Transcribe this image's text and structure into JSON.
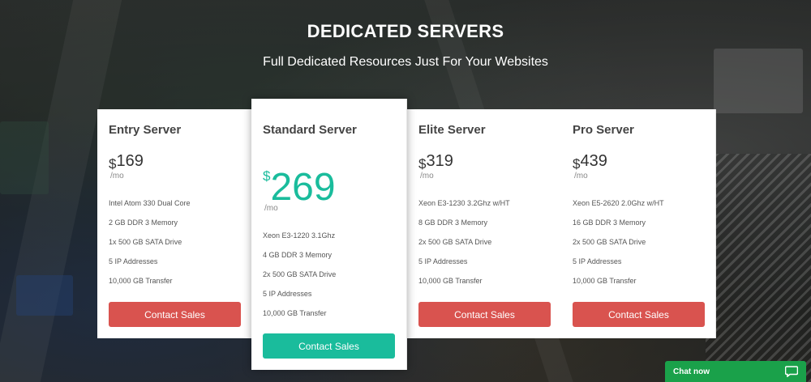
{
  "header": {
    "title": "DEDICATED SERVERS",
    "subtitle": "Full Dedicated Resources Just For Your Websites"
  },
  "plans": [
    {
      "name": "Entry Server",
      "currency": "$",
      "price": "169",
      "period": "/mo",
      "features": [
        "Intel Atom 330 Dual Core",
        "2 GB DDR 3 Memory",
        "1x 500 GB SATA Drive",
        "5 IP Addresses",
        "10,000 GB Transfer"
      ],
      "button": "Contact Sales"
    },
    {
      "name": "Standard Server",
      "currency": "$",
      "price": "269",
      "period": "/mo",
      "features": [
        "Xeon E3-1220 3.1Ghz",
        "4 GB DDR 3 Memory",
        "2x 500 GB SATA Drive",
        "5 IP Addresses",
        "10,000 GB Transfer"
      ],
      "button": "Contact Sales"
    },
    {
      "name": "Elite Server",
      "currency": "$",
      "price": "319",
      "period": "/mo",
      "features": [
        "Xeon E3-1230 3.2Ghz w/HT",
        "8 GB DDR 3 Memory",
        "2x 500 GB SATA Drive",
        "5 IP Addresses",
        "10,000 GB Transfer"
      ],
      "button": "Contact Sales"
    },
    {
      "name": "Pro Server",
      "currency": "$",
      "price": "439",
      "period": "/mo",
      "features": [
        "Xeon E5-2620 2.0Ghz w/HT",
        "16 GB DDR 3 Memory",
        "2x 500 GB SATA Drive",
        "5 IP Addresses",
        "10,000 GB Transfer"
      ],
      "button": "Contact Sales"
    }
  ],
  "chat": {
    "label": "Chat now",
    "icon": "chat-bubble-icon"
  },
  "colors": {
    "accent": "#1abc9c",
    "button": "#d9534f",
    "chat": "#1aa14a"
  }
}
